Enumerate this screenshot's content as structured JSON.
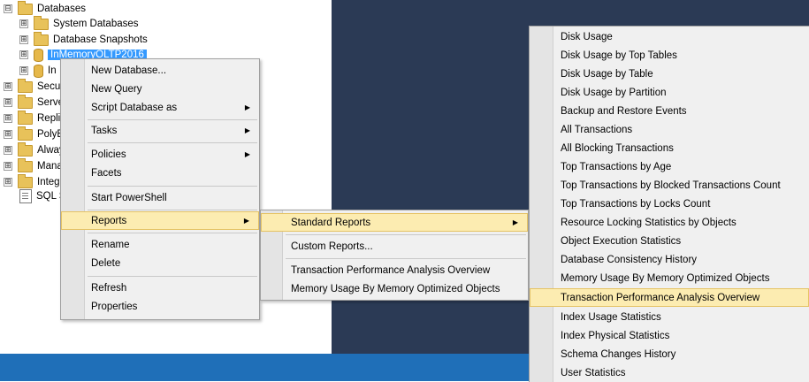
{
  "tree": {
    "items": [
      {
        "label": "Databases",
        "expander": "⊟"
      },
      {
        "label": "System Databases",
        "expander": "⊞"
      },
      {
        "label": "Database Snapshots",
        "expander": "⊞"
      },
      {
        "label": "InMemoryOLTP2016",
        "expander": "⊞"
      },
      {
        "label": "In",
        "expander": "⊞"
      },
      {
        "label": "Secur",
        "expander": "⊞"
      },
      {
        "label": "Serve",
        "expander": "⊞"
      },
      {
        "label": "Replic",
        "expander": "⊞"
      },
      {
        "label": "PolyB",
        "expander": "⊞"
      },
      {
        "label": "Alway",
        "expander": "⊞"
      },
      {
        "label": "Mana",
        "expander": "⊞"
      },
      {
        "label": "Integr",
        "expander": "⊞"
      },
      {
        "label": "SQL S",
        "expander": ""
      }
    ]
  },
  "context_menu": {
    "items": [
      {
        "label": "New Database..."
      },
      {
        "label": "New Query"
      },
      {
        "label": "Script Database as"
      },
      {
        "label": "Tasks"
      },
      {
        "label": "Policies"
      },
      {
        "label": "Facets"
      },
      {
        "label": "Start PowerShell"
      },
      {
        "label": "Reports"
      },
      {
        "label": "Rename"
      },
      {
        "label": "Delete"
      },
      {
        "label": "Refresh"
      },
      {
        "label": "Properties"
      }
    ],
    "submenu_arrow": "▶"
  },
  "reports_menu": {
    "items": [
      {
        "label": "Standard Reports"
      },
      {
        "label": "Custom Reports..."
      },
      {
        "label": "Transaction Performance Analysis Overview"
      },
      {
        "label": "Memory Usage By Memory Optimized Objects"
      }
    ]
  },
  "standard_reports_menu": {
    "items": [
      {
        "label": "Disk Usage"
      },
      {
        "label": "Disk Usage by Top Tables"
      },
      {
        "label": "Disk Usage by Table"
      },
      {
        "label": "Disk Usage by Partition"
      },
      {
        "label": "Backup and Restore Events"
      },
      {
        "label": "All Transactions"
      },
      {
        "label": "All Blocking Transactions"
      },
      {
        "label": "Top Transactions by Age"
      },
      {
        "label": "Top Transactions by Blocked Transactions Count"
      },
      {
        "label": "Top Transactions by Locks Count"
      },
      {
        "label": "Resource Locking Statistics by Objects"
      },
      {
        "label": "Object Execution Statistics"
      },
      {
        "label": "Database Consistency History"
      },
      {
        "label": "Memory Usage By Memory Optimized Objects"
      },
      {
        "label": "Transaction Performance Analysis Overview"
      },
      {
        "label": "Index Usage Statistics"
      },
      {
        "label": "Index Physical Statistics"
      },
      {
        "label": "Schema Changes History"
      },
      {
        "label": "User Statistics"
      }
    ]
  },
  "colors": {
    "highlight": "#fcecb1",
    "selection": "#3399ff",
    "dark_background": "#2b3a55",
    "taskbar_blue": "#1f6fb8"
  }
}
